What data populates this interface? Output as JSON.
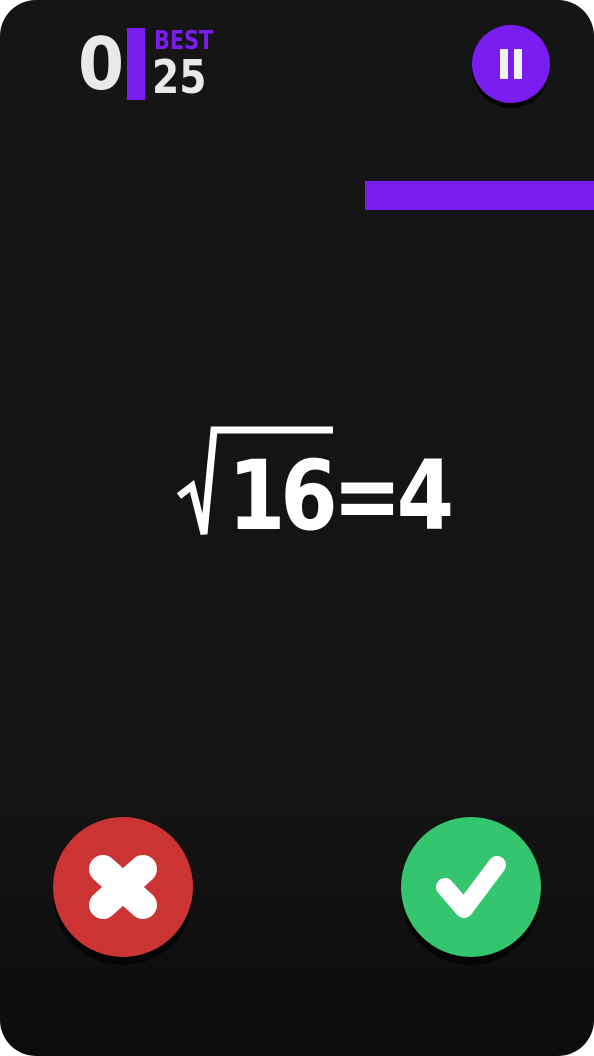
{
  "hud": {
    "score": "0",
    "best_label": "BEST",
    "best_value": "25",
    "pause_icon": "pause-icon"
  },
  "timer": {
    "remaining_fraction": 1.0
  },
  "question": {
    "radical_symbol": "√",
    "radicand": "16",
    "operator": "=",
    "answer": "4"
  },
  "buttons": {
    "wrong_icon": "x-icon",
    "right_icon": "checkmark-icon"
  },
  "colors": {
    "accent": "#7b1cf0",
    "background": "#141414",
    "wrong": "#cc3333",
    "right": "#34c56e",
    "text": "#ffffff",
    "score_text": "#e9e9e9"
  }
}
